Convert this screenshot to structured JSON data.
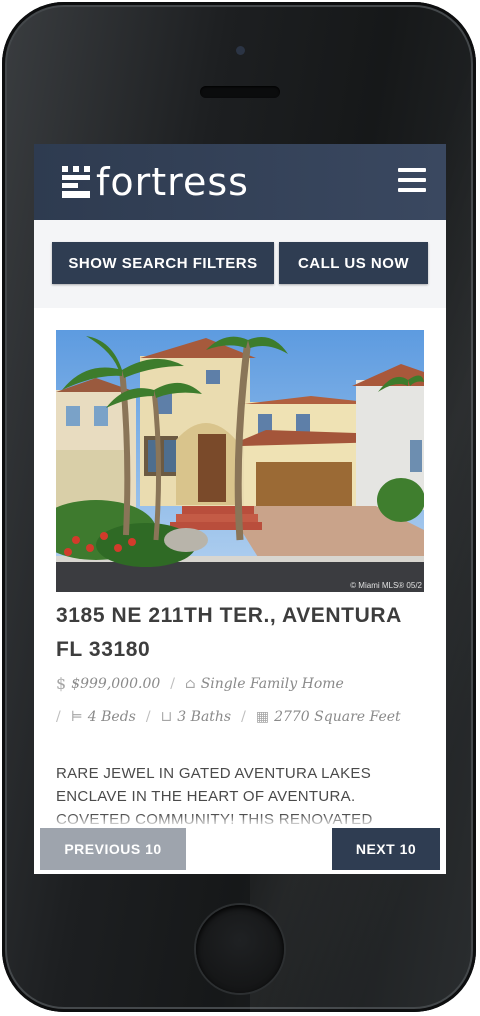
{
  "header": {
    "logo_text": "fortress",
    "menu_icon": "hamburger-menu-icon"
  },
  "actions": {
    "show_filters_label": "SHOW SEARCH FILTERS",
    "call_label": "CALL US NOW"
  },
  "listing": {
    "address_line1": "3185 NE 211TH TER., AVENTURA",
    "address_line2": "FL 33180",
    "price": "$999,000.00",
    "price_icon": "dollar-icon",
    "property_type": "Single Family Home",
    "property_type_icon": "house-icon",
    "beds": "4 Beds",
    "beds_icon": "bed-icon",
    "baths": "3 Baths",
    "baths_icon": "bathtub-icon",
    "area": "2770 Square Feet",
    "area_icon": "floorplan-icon",
    "description": "RARE JEWEL IN GATED AVENTURA LAKES ENCLAVE IN THE HEART OF AVENTURA. COVETED COMMUNITY! THIS RENOVATED CONTEMPORARY",
    "photo_credit": "© Miami MLS® 05/2"
  },
  "pagination": {
    "previous_label": "PREVIOUS 10",
    "next_label": "NEXT 10"
  },
  "colors": {
    "navy": "#2f3d52",
    "muted_button": "#9ea4ad",
    "text_dark": "#3d3d3d"
  }
}
